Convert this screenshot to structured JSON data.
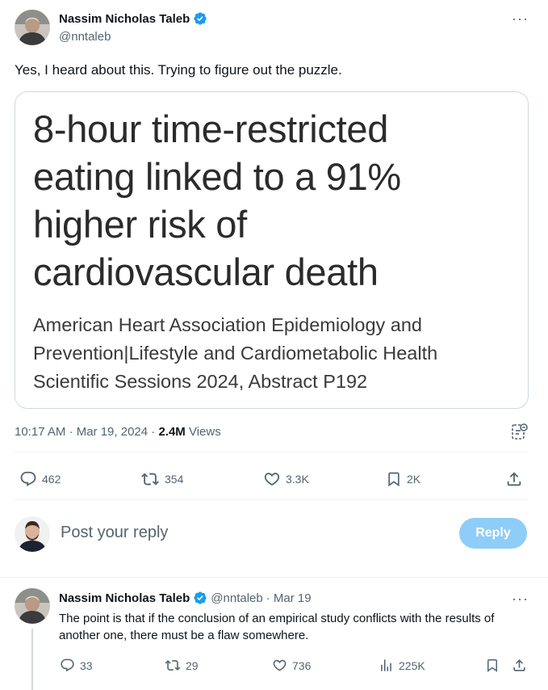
{
  "main_tweet": {
    "author": {
      "name": "Nassim Nicholas Taleb",
      "handle": "@nntaleb"
    },
    "text": "Yes, I heard about this. Trying to figure out the puzzle.",
    "card": {
      "headline_lines": [
        "8-hour time-restricted",
        "eating linked to a 91%",
        "higher risk of",
        "cardiovascular death"
      ],
      "subtitle_lines": [
        "American Heart Association Epidemiology and",
        "Prevention|Lifestyle and Cardiometabolic Health",
        "Scientific Sessions 2024, Abstract P192"
      ]
    },
    "timestamp": "10:17 AM · Mar 19, 2024 · ",
    "views_count": "2.4M",
    "views_label": " Views",
    "actions": {
      "replies": "462",
      "reposts": "354",
      "likes": "3.3K",
      "bookmarks": "2K"
    }
  },
  "composer": {
    "placeholder": "Post your reply",
    "button": "Reply"
  },
  "reply_tweet": {
    "author": {
      "name": "Nassim Nicholas Taleb",
      "handle": "@nntaleb",
      "date": "· Mar 19"
    },
    "text": "The point is that if the conclusion of an empirical study conflicts with the results of another one, there must be a flaw somewhere.",
    "actions": {
      "replies": "33",
      "reposts": "29",
      "likes": "736",
      "views": "225K"
    }
  },
  "colors": {
    "accent": "#1d9bf0",
    "reply_button_disabled": "#8ecdf7",
    "muted_text": "#536471",
    "border": "#cfd9de"
  }
}
